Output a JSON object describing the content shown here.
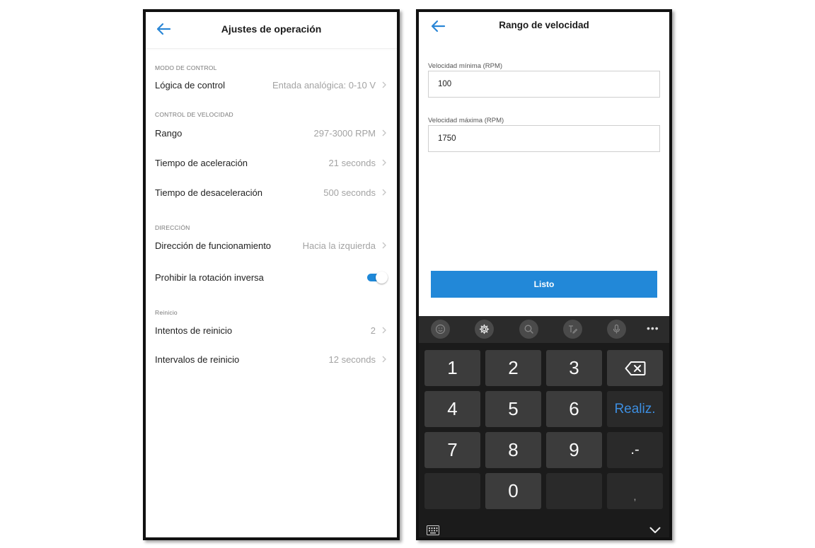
{
  "left": {
    "title": "Ajustes de operación",
    "sections": {
      "control_mode": "MODO DE CONTROL",
      "speed_control": "CONTROL DE VELOCIDAD",
      "direction": "DIRECCIÓN",
      "restart": "Reinicio"
    },
    "rows": {
      "control_logic": {
        "label": "Lógica de control",
        "value": "Entada analógica: 0-10 V"
      },
      "range": {
        "label": "Rango",
        "value": "297-3000 RPM"
      },
      "accel_time": {
        "label": "Tiempo de aceleración",
        "value": "21 seconds"
      },
      "decel_time": {
        "label": "Tiempo de desaceleración",
        "value": "500 seconds"
      },
      "run_direction": {
        "label": "Dirección de funcionamiento",
        "value": "Hacia la izquierda"
      },
      "prohibit_reverse": {
        "label": "Prohibir la rotación inversa",
        "enabled": true
      },
      "restart_attempts": {
        "label": "Intentos de reinicio",
        "value": "2"
      },
      "restart_intervals": {
        "label": "Intervalos de reinicio",
        "value": "12 seconds"
      }
    }
  },
  "right": {
    "title": "Rango de velocidad",
    "min_speed": {
      "label": "Velocidad mínima (RPM)",
      "value": "100"
    },
    "max_speed": {
      "label": "Velocidad máxima (RPM)",
      "value": "1750"
    },
    "done_button": "Listo",
    "keyboard": {
      "toolbar_icons": [
        "emoji-icon",
        "settings-icon",
        "search-icon",
        "handwriting-icon",
        "microphone-icon",
        "more-icon"
      ],
      "more_label": "•••",
      "keys": {
        "k1": "1",
        "k2": "2",
        "k3": "3",
        "k4": "4",
        "k5": "5",
        "k6": "6",
        "k7": "7",
        "k8": "8",
        "k9": "9",
        "k0": "0",
        "done": "Realiz.",
        "dot_minus": ".-",
        "comma": ","
      }
    }
  },
  "colors": {
    "accent": "#2288d8",
    "keyboard_bg": "#1b1b1b",
    "key_bg": "#3c3c3c",
    "done_key_text": "#3d8ee0"
  }
}
